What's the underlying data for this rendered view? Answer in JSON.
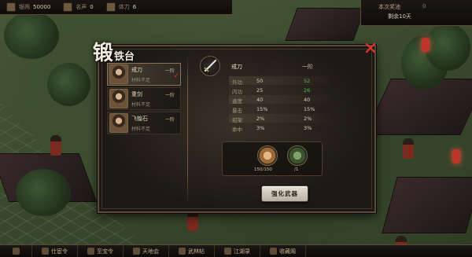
{
  "hud": {
    "money_label": "银两",
    "money_value": "50000",
    "fame_label": "名声",
    "fame_value": "0",
    "stamina_label": "体力",
    "stamina_value": "6",
    "right_line1": "本次奖池",
    "right_line1_value": "0",
    "right_line2": "剩余10天"
  },
  "panel": {
    "title_big": "锻",
    "title_small": "铁台",
    "weapons": [
      {
        "name": "戒刀",
        "level": "一阶",
        "sub": "材料不足"
      },
      {
        "name": "重剑",
        "level": "一阶",
        "sub": "材料不足"
      },
      {
        "name": "飞蝗石",
        "level": "一阶",
        "sub": "材料不足"
      }
    ],
    "detail": {
      "name": "戒刀",
      "level": "一阶",
      "stats": [
        {
          "label": "外功",
          "current": "50",
          "next": "52",
          "up": true
        },
        {
          "label": "内功",
          "current": "25",
          "next": "26",
          "up": true
        },
        {
          "label": "速度",
          "current": "40",
          "next": "40",
          "up": false
        },
        {
          "label": "暴击",
          "current": "15%",
          "next": "15%",
          "up": false
        },
        {
          "label": "招架",
          "current": "2%",
          "next": "2%",
          "up": false
        },
        {
          "label": "命中",
          "current": "3%",
          "next": "3%",
          "up": false
        }
      ],
      "materials": [
        {
          "icon": "ore-icon",
          "count": "150/150"
        },
        {
          "icon": "herb-icon",
          "count": "/1"
        }
      ]
    },
    "forge_button": "强化武器"
  },
  "bottom_bar": {
    "items": [
      "仕宦令",
      "至宝令",
      "天地会",
      "武林帖",
      "江湖录",
      "收藏阁"
    ]
  }
}
